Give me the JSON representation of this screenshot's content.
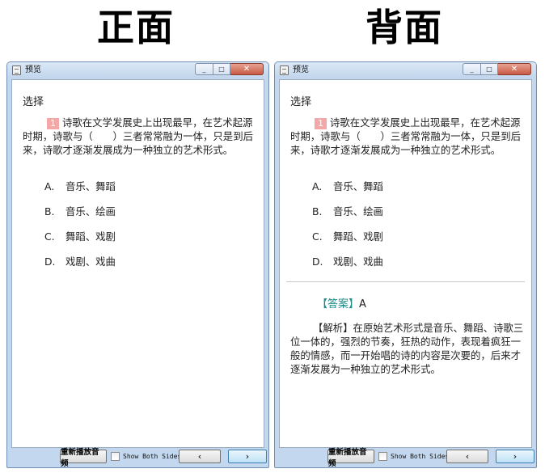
{
  "labels": {
    "front": "正面",
    "back": "背面"
  },
  "window": {
    "title": "预览",
    "min_glyph": "_",
    "max_glyph": "□",
    "close_glyph": "✕"
  },
  "card": {
    "heading": "选择",
    "question_number": "1",
    "question_text": "诗歌在文学发展史上出现最早，在艺术起源时期，诗歌与（　　）三者常常融为一体，只是到后来，诗歌才逐渐发展成为一种独立的艺术形式。",
    "options": [
      {
        "letter": "A.",
        "text": "音乐、舞蹈"
      },
      {
        "letter": "B.",
        "text": "音乐、绘画"
      },
      {
        "letter": "C.",
        "text": "舞蹈、戏剧"
      },
      {
        "letter": "D.",
        "text": "戏剧、戏曲"
      }
    ],
    "answer_label": "【答案】",
    "answer_value": "A",
    "analysis_text": "【解析】在原始艺术形式是音乐、舞蹈、诗歌三位一体的，强烈的节奏，狂热的动作，表现着疯狂一般的情感，而一开始唱的诗的内容是次要的，后来才逐渐发展为一种独立的艺术形式。"
  },
  "footer": {
    "replay_label": "重新播放音频",
    "show_both_label": "Show Both Sides",
    "prev_label": "‹",
    "next_label": "›"
  }
}
